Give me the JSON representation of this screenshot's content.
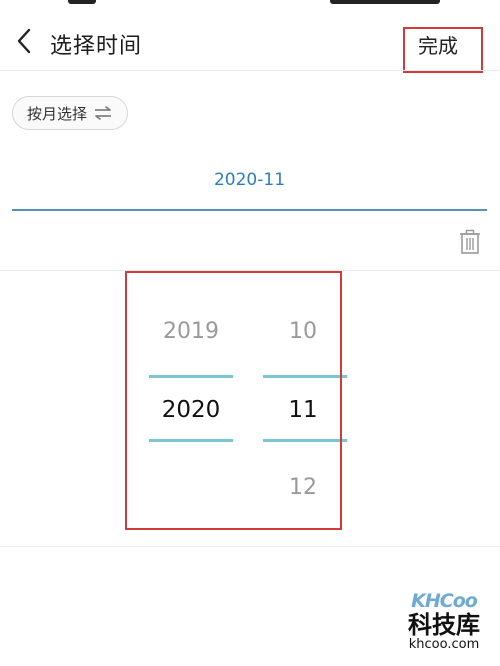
{
  "header": {
    "title": "选择时间",
    "done_label": "完成"
  },
  "toggle": {
    "label": "按月选择"
  },
  "selected_date": "2020-11",
  "picker": {
    "year_column": [
      "2019",
      "2020",
      ""
    ],
    "month_column": [
      "10",
      "11",
      "12"
    ],
    "selected_year": "2020",
    "selected_month": "11"
  },
  "colors": {
    "accent_text": "#2b7fc1",
    "selection_line": "#7cc4d8",
    "annotation_box": "#d23a3a"
  },
  "watermark": {
    "logo": "KHCoo",
    "name": "科技库",
    "url": "khcoo.com"
  }
}
